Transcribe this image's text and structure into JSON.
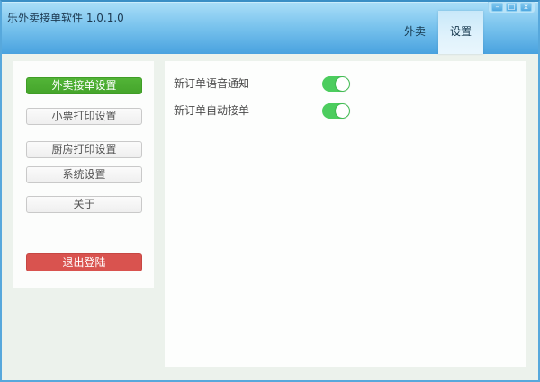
{
  "window": {
    "title": "乐外卖接单软件 1.0.1.0",
    "controls": {
      "minimize": "–",
      "maximize": "□",
      "close": "x"
    }
  },
  "header": {
    "tabs": [
      {
        "label": "外卖",
        "active": false
      },
      {
        "label": "设置",
        "active": true
      }
    ]
  },
  "sidebar": {
    "items": [
      {
        "label": "外卖接单设置",
        "active": true
      },
      {
        "label": "小票打印设置",
        "active": false
      },
      {
        "label": "厨房打印设置",
        "active": false
      },
      {
        "label": "系统设置",
        "active": false
      },
      {
        "label": "关于",
        "active": false
      }
    ],
    "logout_label": "退出登陆"
  },
  "settings_panel": {
    "rows": [
      {
        "label": "新订单语音通知",
        "enabled": true
      },
      {
        "label": "新订单自动接单",
        "enabled": true
      }
    ]
  },
  "colors": {
    "titlebar_top": "#abdef8",
    "titlebar_bottom": "#49a2df",
    "window_border": "#57a8dc",
    "content_bg": "#ecf2ec",
    "active_sidebar_green": "#49ab2e",
    "toggle_on_green": "#4ccd5e",
    "logout_red": "#d9534f"
  }
}
